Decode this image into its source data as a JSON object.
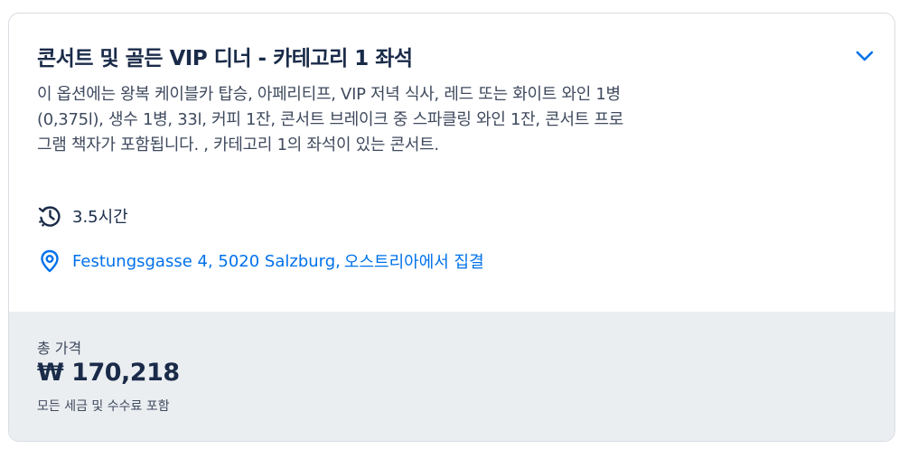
{
  "option": {
    "title": "콘서트 및 골든 VIP 디너 - 카테고리 1 좌석",
    "description": "이 옵션에는 왕복 케이블카 탑승, 아페리티프, VIP 저녁 식사, 레드 또는 화이트 와인 1병(0,375l), 생수 1병, 33l, 커피 1잔, 콘서트 브레이크 중 스파클링 와인 1잔, 콘서트 프로그램 책자가 포함됩니다. , 카테고리 1의 좌석이 있는 콘서트.",
    "duration": "3.5시간",
    "address": "Festungsgasse 4, 5020 Salzburg,",
    "meeting_text": "오스트리아에서 집결"
  },
  "pricing": {
    "total_label": "총 가격",
    "price": "₩ 170,218",
    "tax_note": "모든 세금 및 수수료 포함"
  },
  "icons": {
    "expand": "chevron-down-icon",
    "duration": "history-clock-icon",
    "location": "map-pin-icon"
  },
  "colors": {
    "link": "#0071eb",
    "text": "#1a2b49",
    "footer_bg": "#ebeef1"
  }
}
